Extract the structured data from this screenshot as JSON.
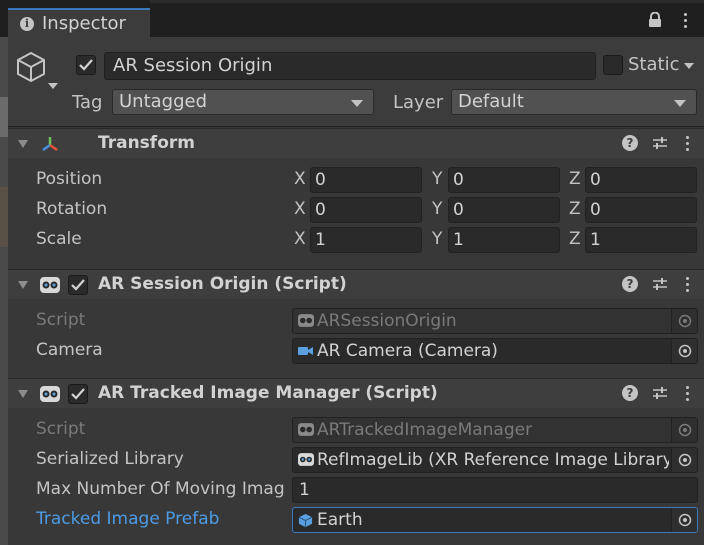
{
  "tab": {
    "label": "Inspector"
  },
  "header": {
    "object_name": "AR Session Origin",
    "static_label": "Static",
    "tag_label": "Tag",
    "tag_value": "Untagged",
    "layer_label": "Layer",
    "layer_value": "Default"
  },
  "transform": {
    "title": "Transform",
    "rows": [
      {
        "label": "Position",
        "x": "0",
        "y": "0",
        "z": "0"
      },
      {
        "label": "Rotation",
        "x": "0",
        "y": "0",
        "z": "0"
      },
      {
        "label": "Scale",
        "x": "1",
        "y": "1",
        "z": "1"
      }
    ],
    "axes": {
      "x": "X",
      "y": "Y",
      "z": "Z"
    }
  },
  "session_origin": {
    "title": "AR Session Origin (Script)",
    "script_label": "Script",
    "script_value": "ARSessionOrigin",
    "camera_label": "Camera",
    "camera_value": "AR Camera (Camera)"
  },
  "image_manager": {
    "title": "AR Tracked Image Manager (Script)",
    "script_label": "Script",
    "script_value": "ARTrackedImageManager",
    "library_label": "Serialized Library",
    "library_value": "RefImageLib (XR Reference Image Library)",
    "max_label": "Max Number Of Moving Imag",
    "max_value": "1",
    "prefab_label": "Tracked Image Prefab",
    "prefab_value": "Earth"
  },
  "colors": {
    "accent": "#3a79bb",
    "link": "#4d9be6",
    "background": "#383838"
  }
}
